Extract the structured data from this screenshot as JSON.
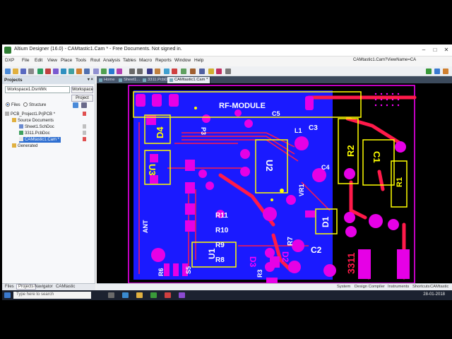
{
  "window": {
    "title": "Altium Designer (16.0) - CAMtastic1.Cam * - Free Documents. Not signed in.",
    "minimize": "–",
    "maximize": "□",
    "close": "✕"
  },
  "menu": {
    "items": [
      "DXP",
      "File",
      "Edit",
      "View",
      "Place",
      "Tools",
      "Rout",
      "Analysis",
      "Tables",
      "Macro",
      "Reports",
      "Window",
      "Help"
    ],
    "path": "CAMtastic1.Cam?ViewName=CA"
  },
  "panel": {
    "title": "Projects",
    "controls": "▾ ×",
    "workspace": "Workspace1.DsnWrk",
    "workspace_btn": "Workspace",
    "project_btn": "Project",
    "radio_files": "Files",
    "radio_structure": "Structure",
    "tree": {
      "project": "PCB_Project1.PrjPCB *",
      "source_documents": "Source Documents",
      "sheet": "Sheet1.SchDoc",
      "pcb": "3311.PcbDoc",
      "cam": "CAMtastic1.Cam *",
      "generated": "Generated"
    },
    "tabs": [
      "Files",
      "Projects",
      "Navigator",
      "CAMtastic"
    ]
  },
  "doctabs": [
    "Home",
    "Sheet1...",
    "3311.PcbDoc",
    "CAMtastic1.Cam *"
  ],
  "pcb": {
    "module_label": "RF-MODULE",
    "labels": {
      "d4": "D4",
      "p3": "P3",
      "u3": "U3",
      "ant": "ANT",
      "r11": "R11",
      "r10": "R10",
      "r9": "R9",
      "r8": "R8",
      "u2": "U2",
      "c5": "C5",
      "c3": "C3",
      "c4": "C4",
      "l1": "L1",
      "vr1": "VR1",
      "r2": "R2",
      "c1": "C1",
      "r1": "R1",
      "d1": "D1",
      "r7": "R7",
      "u1": "U1",
      "d3": "D3",
      "d2": "D2",
      "c2": "C2",
      "r3": "R3",
      "r6": "R6",
      "s5": "S5",
      "board": "3311"
    },
    "colors": {
      "background": "#000000",
      "copper_bottom": "#1a1aff",
      "trace": "#ff1a4a",
      "pad": "#e600e6",
      "silk": "#ffff00",
      "outline": "#ff00ff"
    }
  },
  "status": {
    "items": [
      "System",
      "Design Compiler",
      "Instruments",
      "Shortcuts",
      "CAMtastic"
    ]
  },
  "taskbar": {
    "search_placeholder": "Type here to search",
    "date": "28-01-2018"
  }
}
